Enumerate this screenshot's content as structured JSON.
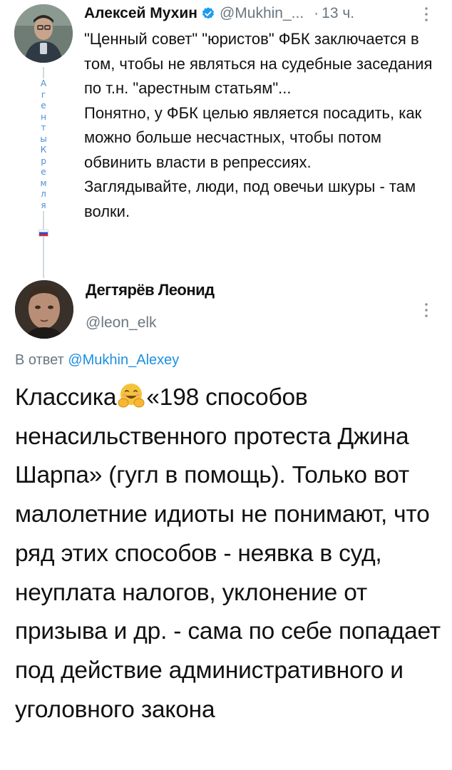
{
  "parent_tweet": {
    "author_name": "Алексей Мухин",
    "author_handle": "@Mukhin_...",
    "separator": "·",
    "time": "13 ч.",
    "vertical_caption": [
      "А",
      "г",
      "е",
      "н",
      "т",
      "ы",
      "К",
      "р",
      "е",
      "м",
      "л",
      "я"
    ],
    "text": "\"Ценный совет\" \"юристов\" ФБК заключается в том, чтобы не являться на судебные заседания по т.н. \"арестным статьям\"...\nПонятно, у ФБК целью является посадить, как можно больше несчастных, чтобы потом обвинить власти в репрессиях.\nЗаглядывайте, люди, под овечьи шкуры - там волки."
  },
  "reply_tweet": {
    "author_name": "Дегтярёв Леонид",
    "author_handle": "@leon_elk",
    "reply_prefix": "В ответ",
    "reply_to_handle": "@Mukhin_Alexey",
    "text_before_emoji": "Классика",
    "emoji": "hugging-face-emoji",
    "text_after_emoji": "«198 способов ненасильственного протеста Джина Шарпа» (гугл в помощь). Только вот малолетние идиоты не понимают, что ряд этих способов - неявка в суд, неуплата налогов, уклонение от призыва и др. - сама по себе попадает под действие административного и уголовного закона"
  },
  "icons": {
    "verified": "verified-badge-icon",
    "more": "more-options-icon",
    "flag": "russian-flag-icon"
  },
  "colors": {
    "text": "#111111",
    "secondary_text": "#6b7780",
    "link": "#1d8fe0",
    "verified": "#1d9bf0",
    "thread_line": "#cfd9de"
  }
}
